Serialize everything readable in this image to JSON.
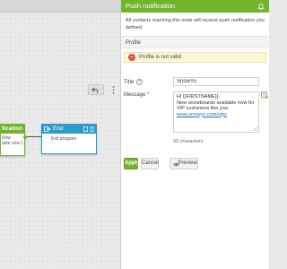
{
  "canvas": {
    "undo_icon": "undo-icon",
    "more_icon": "more-vertical-icon",
    "push_node": {
      "title": "fication",
      "line1": "Now",
      "line2": "able now f..."
    },
    "end_node": {
      "title": "End",
      "body": "Exit program"
    }
  },
  "panel": {
    "title": "Push notification",
    "info": "All contacts reaching this node will receive push notification you defined.",
    "profile_label": "Profile",
    "warning": "Profile is not valid",
    "title_label": "Title",
    "title_value": "SnowYo",
    "message_label": "Message *",
    "message_line1": "Hi {{FIRSTNAME}},",
    "message_line2": "New snowboards available now for VIP customers like you:",
    "message_link": "www.snowyo.com/vips",
    "char_count": "93 characters",
    "apply_label": "Apply",
    "cancel_label": "Cancel",
    "preview_label": "Preview"
  },
  "colors": {
    "accent": "#71b52c",
    "end_node": "#2c9bc9",
    "warning_bg": "#fbf6d6",
    "error": "#d9534f"
  }
}
